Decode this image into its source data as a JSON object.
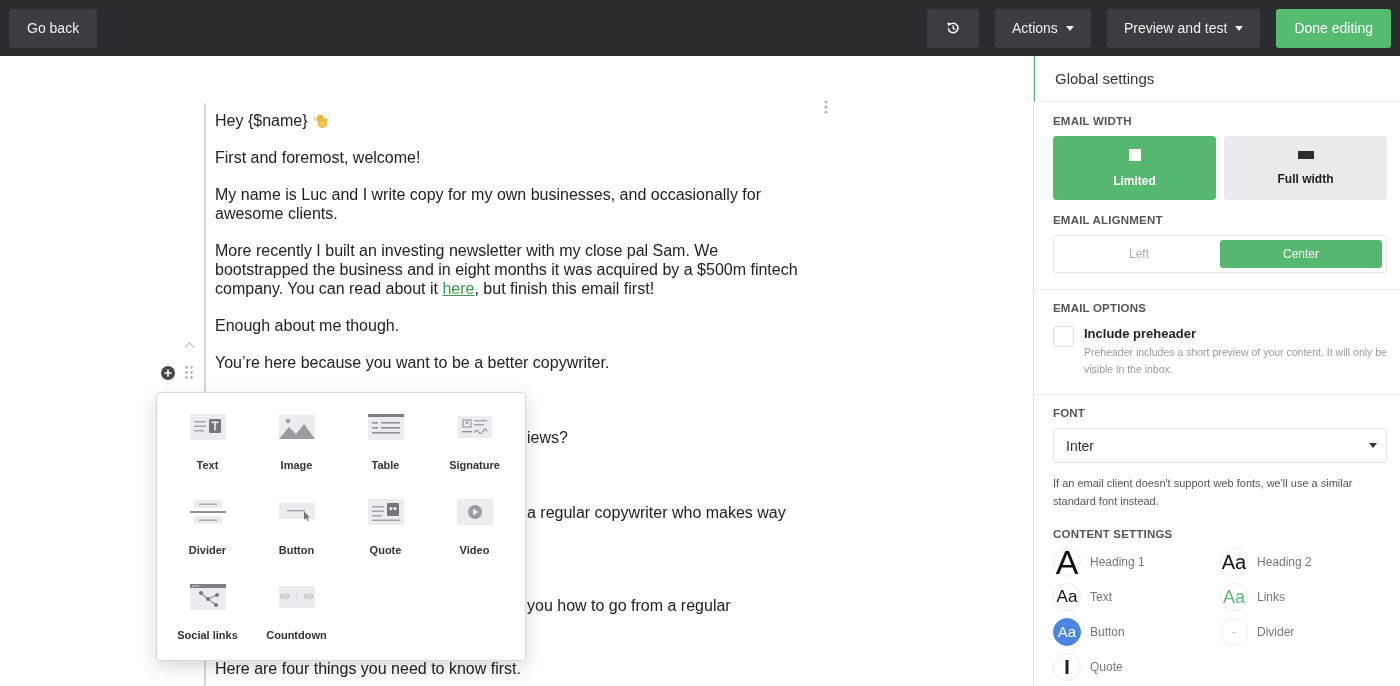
{
  "toolbar": {
    "back_button": "Go back",
    "buttons": [
      {
        "kind": "history"
      },
      {
        "kind": "dropdown",
        "label": "Actions"
      },
      {
        "kind": "dropdown",
        "label": "Preview and test"
      },
      {
        "kind": "primary",
        "label": "Done editing"
      }
    ]
  },
  "editor": {
    "paragraphs": [
      {
        "kind": "greeting",
        "segments": [
          {
            "kind": "plain",
            "text": "Hey {$name}"
          }
        ]
      },
      {
        "kind": "text",
        "segments": [
          {
            "kind": "plain",
            "text": "First and foremost, welcome!"
          }
        ]
      },
      {
        "kind": "text",
        "segments": [
          {
            "kind": "plain",
            "text": "My name is Luc and I write copy for my own businesses, and occasionally for\nawesome clients."
          }
        ]
      },
      {
        "kind": "text",
        "segments": [
          {
            "kind": "plain",
            "text": "More recently I built an investing newsletter with my close pal Sam. We\nbootstrapped the business and in eight months it was acquired by a $500m fintech\ncompany. You can read about it "
          },
          {
            "kind": "link",
            "text": "here"
          },
          {
            "kind": "plain",
            "text": ", but finish this email first!"
          }
        ]
      },
      {
        "kind": "text",
        "segments": [
          {
            "kind": "plain",
            "text": "Enough about me though."
          }
        ]
      },
      {
        "kind": "text",
        "segments": [
          {
            "kind": "plain",
            "text": "You’re here because you want to be a better copywriter."
          }
        ]
      },
      {
        "kind": "covered",
        "segments": [
          {
            "kind": "plain",
            "text": "iews?"
          }
        ]
      },
      {
        "kind": "covered",
        "segments": [
          {
            "kind": "plain",
            "text": "a regular copywriter who makes way"
          }
        ]
      },
      {
        "kind": "covered",
        "segments": [
          {
            "kind": "plain",
            "text": "you how to go from a regular"
          }
        ]
      },
      {
        "kind": "text",
        "segments": [
          {
            "kind": "plain",
            "text": "Here are four things you need to know first."
          }
        ]
      }
    ],
    "block_menu": {
      "items": [
        {
          "kind": "text",
          "label": "Text"
        },
        {
          "kind": "image",
          "label": "Image"
        },
        {
          "kind": "table",
          "label": "Table"
        },
        {
          "kind": "signature",
          "label": "Signature"
        },
        {
          "kind": "divider",
          "label": "Divider"
        },
        {
          "kind": "button",
          "label": "Button"
        },
        {
          "kind": "quote",
          "label": "Quote"
        },
        {
          "kind": "video",
          "label": "Video"
        },
        {
          "kind": "social",
          "label": "Social links"
        },
        {
          "kind": "countdown",
          "label": "Countdown",
          "icon_text": "00 : 00"
        }
      ]
    }
  },
  "settings": {
    "title": "Global settings",
    "email_width": {
      "label": "EMAIL WIDTH",
      "options": [
        {
          "kind": "limited",
          "label": "Limited",
          "selected": true
        },
        {
          "kind": "full",
          "label": "Full width",
          "selected": false
        }
      ]
    },
    "email_alignment": {
      "label": "EMAIL ALIGNMENT",
      "options": [
        {
          "label": "Left",
          "selected": false
        },
        {
          "label": "Center",
          "selected": true
        }
      ]
    },
    "email_options": {
      "label": "EMAIL OPTIONS",
      "items": [
        {
          "label": "Include preheader",
          "description": "Preheader includes a short preview of your content. It will only be visible in the inbox.",
          "checked": false
        }
      ]
    },
    "font": {
      "label": "FONT",
      "value": "Inter",
      "hint": "If an email client doesn't support web fonts, we'll use a similar standard font instead."
    },
    "content_settings": {
      "label": "CONTENT SETTINGS",
      "items": [
        {
          "kind": "heading1",
          "label": "Heading 1",
          "sample": "A"
        },
        {
          "kind": "heading2",
          "label": "Heading 2",
          "sample": "Aa"
        },
        {
          "kind": "text",
          "label": "Text",
          "sample": "Aa"
        },
        {
          "kind": "links",
          "label": "Links",
          "sample": "Aa"
        },
        {
          "kind": "button",
          "label": "Button",
          "sample": "Aa"
        },
        {
          "kind": "divider",
          "label": "Divider"
        },
        {
          "kind": "quote",
          "label": "Quote"
        }
      ]
    }
  }
}
